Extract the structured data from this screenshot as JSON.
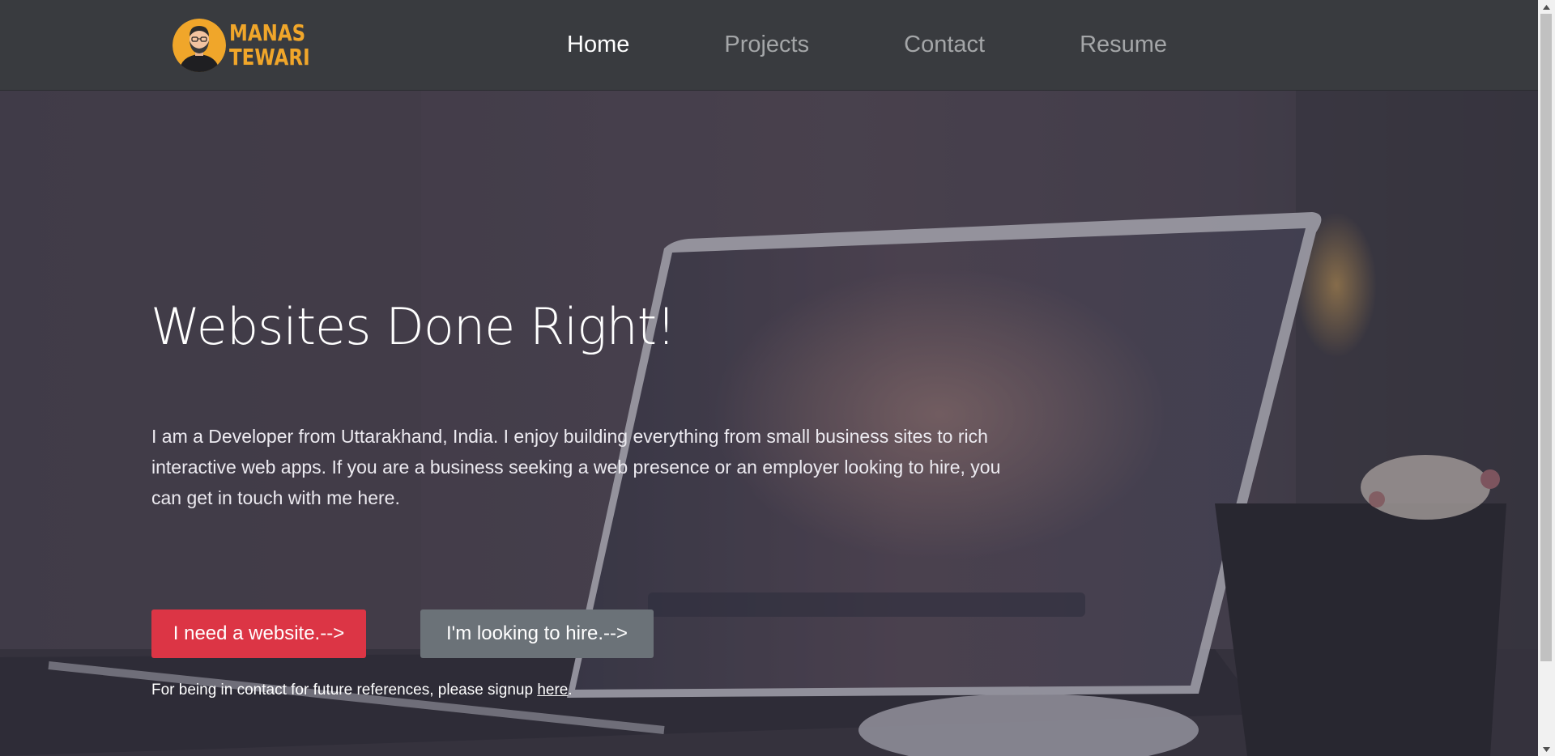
{
  "brand": {
    "name_line1": "MANAS",
    "name_line2": "TEWARI",
    "accent_color": "#f0a62a",
    "avatar_icon": "bearded-man-avatar-icon"
  },
  "nav": {
    "items": [
      {
        "label": "Home",
        "active": true
      },
      {
        "label": "Projects",
        "active": false
      },
      {
        "label": "Contact",
        "active": false
      },
      {
        "label": "Resume",
        "active": false
      }
    ]
  },
  "hero": {
    "title": "Websites Done Right!",
    "description": "I am a Developer from Uttarakhand, India. I enjoy building everything from small business sites to rich interactive web apps. If you are a business seeking a web presence or an employer looking to hire, you can get in touch with me here.",
    "primary_button": "I need a website.-->",
    "secondary_button": "I'm looking to hire.-->",
    "signup_prefix": "For being in contact for future references, please signup ",
    "signup_link": "here",
    "signup_suffix": ".",
    "background_image": "laptop-on-desk-photo"
  },
  "colors": {
    "navbar_bg": "#393b3f",
    "primary_button": "#dc3545",
    "secondary_button": "#6b7278"
  }
}
